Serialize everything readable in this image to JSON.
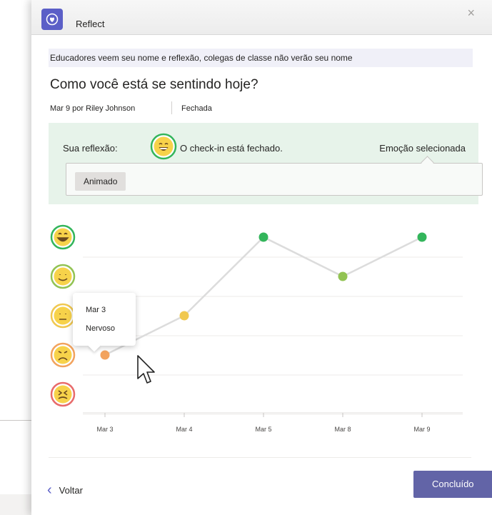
{
  "window": {
    "app_title": "Reflect",
    "close_glyph": "×"
  },
  "notice": "Educadores veem seu nome e reflexão, colegas de classe não verão seu nome",
  "question": "Como você está se sentindo hoje?",
  "meta": {
    "byline": "Mar 9 por Riley Johnson",
    "status": "Fechada"
  },
  "reflection": {
    "label": "Sua reflexão:",
    "closed_text": "O check-in está fechado.",
    "selected_label": "Emoção selecionada",
    "selected_emotion": "Animado",
    "emoji_icon": "grinning-face-icon"
  },
  "chart_data": {
    "type": "line",
    "categories": [
      "Mar 3",
      "Mar 4",
      "Mar 5",
      "Mar 8",
      "Mar 9"
    ],
    "y_levels": [
      "very-sad",
      "sad",
      "neutral",
      "happy",
      "very-happy"
    ],
    "values": [
      2,
      3,
      5,
      4,
      5
    ],
    "level_icons": [
      "tired-face-icon",
      "worried-face-icon",
      "neutral-face-icon",
      "smiling-face-icon",
      "grinning-face-icon"
    ],
    "level_colors": [
      "#e86b6b",
      "#f2a35e",
      "#f0c850",
      "#92c353",
      "#33b55b"
    ],
    "ylim": [
      1,
      5
    ],
    "grid": true
  },
  "tooltip": {
    "date": "Mar 3",
    "emotion": "Nervoso"
  },
  "footer": {
    "back_label": "Voltar",
    "done_label": "Concluído"
  },
  "colors": {
    "accent": "#6264a7",
    "reflection_bg": "#e7f3ea",
    "notice_bg": "#f0f0f8"
  }
}
